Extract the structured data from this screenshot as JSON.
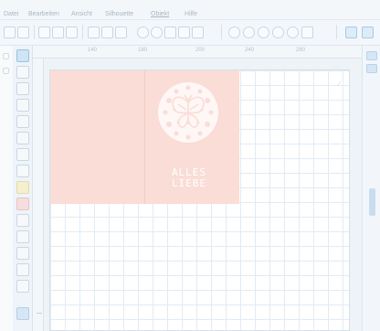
{
  "menu": {
    "items": [
      "Datei",
      "Bearbeiten",
      "Ansicht",
      "Silhouette",
      "Objekt",
      "Hilfe"
    ]
  },
  "toolbar": {
    "icons": [
      "new-icon",
      "open-icon",
      "save-icon",
      "print-icon",
      "cut-settings-icon",
      "copy-icon",
      "paste-icon",
      "select-all-icon",
      "undo-icon",
      "redo-icon",
      "group-icon",
      "ungroup-icon",
      "zoom-in-icon",
      "zoom-out-icon",
      "zoom-fit-icon",
      "zoom-select-icon",
      "pan-icon",
      "move-icon",
      "page-setup-icon",
      "cut-panel-icon"
    ]
  },
  "ruler": {
    "labels": [
      "140",
      "180",
      "200",
      "240",
      "280"
    ]
  },
  "card": {
    "text_line1": "ALLES",
    "text_line2": "LIEBE"
  },
  "colors": {
    "card_fill": "#f9ddd6",
    "emblem_fill": "#fff7f5",
    "grid_line": "#e2ebf3",
    "accent": "#b5cfe7"
  }
}
